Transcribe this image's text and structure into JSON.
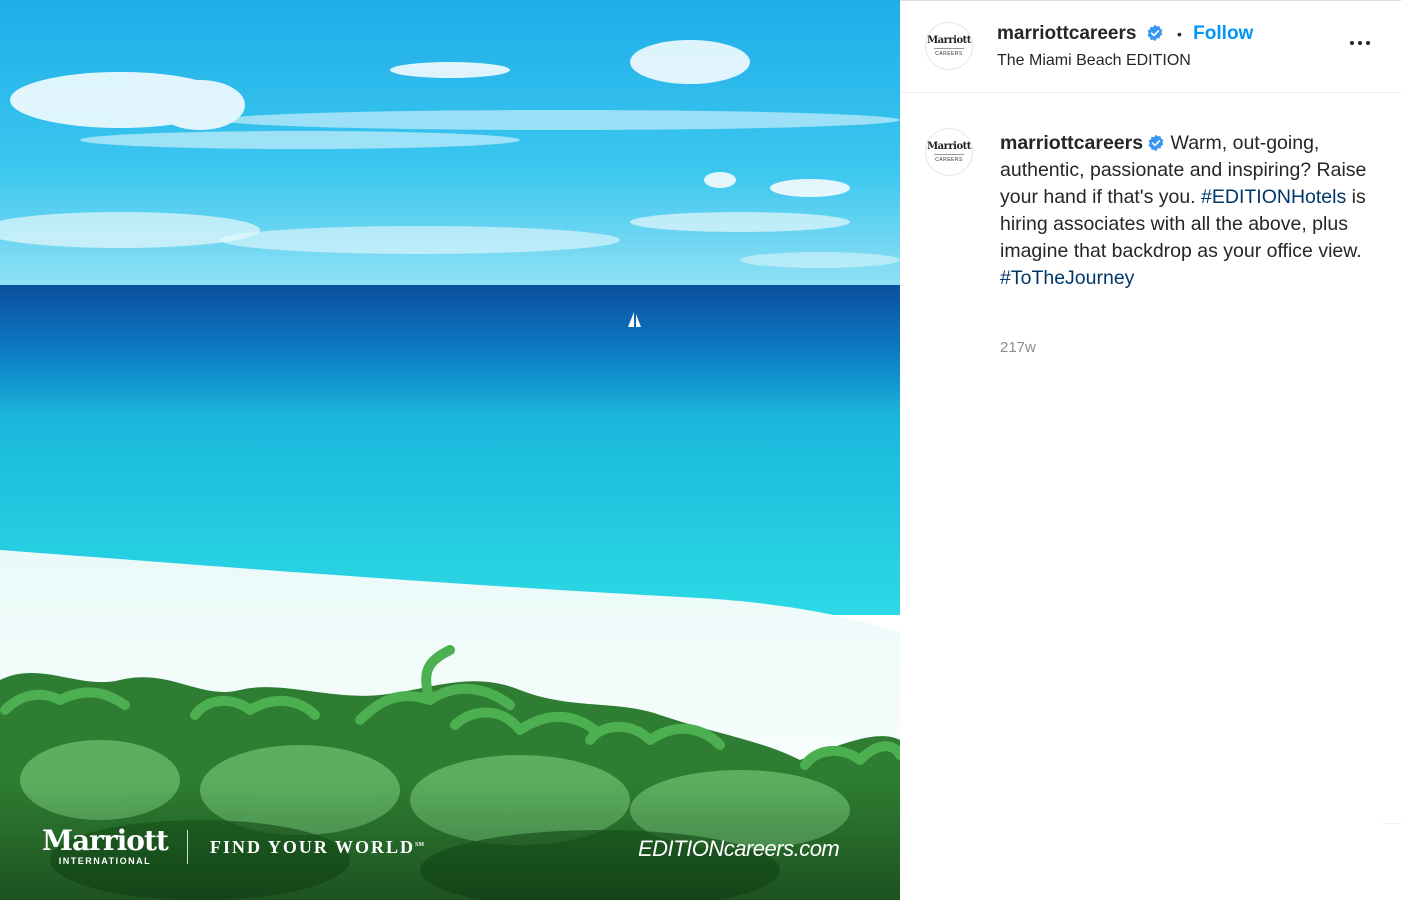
{
  "photo": {
    "brand_logo": "Marriott",
    "brand_sub": "INTERNATIONAL",
    "tagline": "FIND YOUR WORLD",
    "tagline_mark": "SM",
    "url": "EDITIONcareers.com"
  },
  "header": {
    "username": "marriottcareers",
    "separator": "•",
    "follow_label": "Follow",
    "location": "The Miami Beach EDITION",
    "more_icon": "more-horizontal-icon"
  },
  "avatar": {
    "logo": "Marriott",
    "sub": "CAREERS"
  },
  "caption": {
    "username": "marriottcareers",
    "text_1": "Warm, out-going, authentic, passionate and inspiring? Raise your hand if that's you.",
    "hashtag_1": "#EDITIONHotels",
    "text_2": "is hiring associates with all the above, plus imagine that backdrop as your office view.",
    "hashtag_2": "#ToTheJourney",
    "time": "217w"
  },
  "colors": {
    "follow": "#0095f6",
    "hashtag": "#00376b",
    "verified": "#3897f0",
    "muted": "#8e8e8e"
  }
}
